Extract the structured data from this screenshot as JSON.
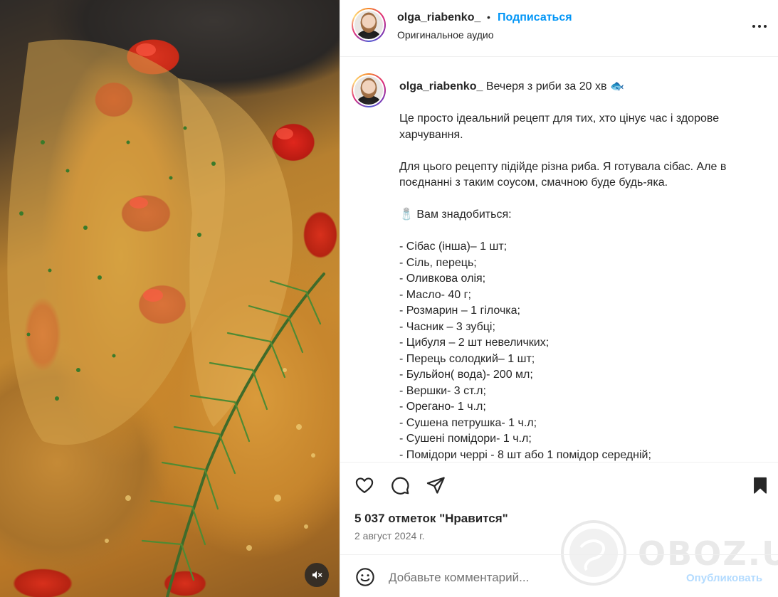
{
  "header": {
    "username": "olga_riabenko_",
    "separator": "•",
    "follow_label": "Подписаться",
    "audio_label": "Оригинальное аудио",
    "more_icon": "more-horizontal-icon"
  },
  "caption": {
    "username": "olga_riabenko_",
    "title": "Вечеря з риби за 20 хв",
    "title_emoji": "🐟",
    "intro": "Це просто ідеальний рецепт для тих, хто цінує час і здорове харчування.",
    "paragraph2": "Для цього рецепту підійде різна риба. Я готувала сібас. Але в поєднанні з таким соусом, смачною буде будь-яка.",
    "needs_emoji": "🧂",
    "needs_label": "Вам знадобиться:",
    "ingredients": [
      "- Сібас (інша)– 1 шт;",
      "- Сіль, перець;",
      "- Оливкова олія;",
      "- Масло- 40 г;",
      "- Розмарин – 1 гілочка;",
      "- Часник – 3 зубці;",
      "- Цибуля – 2 шт невеличких;",
      "- Перець солодкий– 1 шт;",
      "- Бульйон( вода)- 200 мл;",
      "- Вершки- 3 ст.л;",
      "- Орегано- 1 ч.л;",
      "- Сушена петрушка- 1 ч.л;",
      "- Сушені помідори- 1 ч.л;",
      "- Помідори черрі - 8 шт або 1 помідор середній;"
    ]
  },
  "actions": {
    "like_icon": "heart-icon",
    "comment_icon": "comment-icon",
    "share_icon": "send-icon",
    "save_icon": "bookmark-icon",
    "likes_text": "5 037 отметок \"Нравится\"",
    "date_text": "2 август 2024 г."
  },
  "comment": {
    "emoji_icon": "smiley-icon",
    "placeholder": "Добавьте комментарий...",
    "publish_label": "Опубликовать"
  },
  "media": {
    "mute_icon": "speaker-muted-icon"
  },
  "watermark": {
    "text": "OBOZ.UA"
  },
  "colors": {
    "accent": "#0095f6",
    "publish_disabled": "#b3dbff",
    "text": "#262626",
    "muted": "#737373"
  }
}
